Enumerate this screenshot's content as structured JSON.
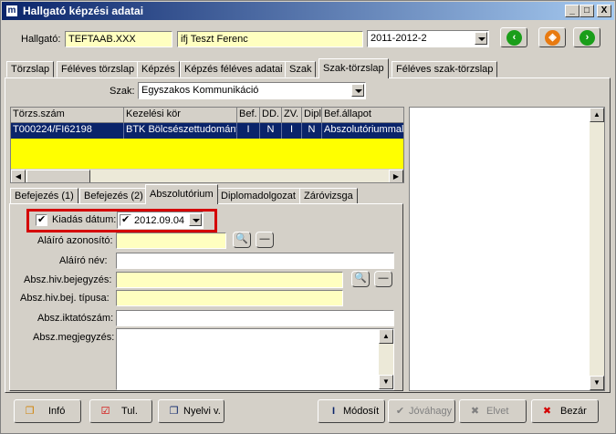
{
  "window": {
    "title": "Hallgató képzési adatai",
    "min": "_",
    "max": "□",
    "close": "X"
  },
  "header": {
    "student_label": "Hallgató:",
    "student_code": "TEFTAAB.XXX",
    "student_name": "ifj Teszt Ferenc",
    "semester": "2011-2012-2"
  },
  "main_tabs": [
    "Törzslap",
    "Féléves törzslap",
    "Képzés",
    "Képzés féléves adatai",
    "Szak",
    "Szak-törzslap",
    "Féléves szak-törzslap"
  ],
  "szak": {
    "label": "Szak:",
    "value": "Egyszakos Kommunikáció"
  },
  "grid": {
    "columns": [
      "Törzs.szám",
      "Kezelési kör",
      "Bef.",
      "DD.",
      "ZV.",
      "Dipl",
      "Bef.állapot"
    ],
    "rows": [
      [
        "T000224/FI62198",
        "BTK Bölcsészettudomány",
        "I",
        "N",
        "I",
        "N",
        "Abszolutóriummal"
      ]
    ]
  },
  "sub_tabs": [
    "Befejezés (1)",
    "Befejezés (2)",
    "Abszolutórium",
    "Diplomadolgozat",
    "Záróvizsga"
  ],
  "form": {
    "issue_date_label": "Kiadás dátum:",
    "issue_date": "2012.09.04",
    "signer_id_label": "Aláíró azonosító:",
    "signer_name_label": "Aláíró név:",
    "abs_ref_label": "Absz.hiv.bejegyzés:",
    "abs_ref_type_label": "Absz.hiv.bej. típusa:",
    "abs_file_label": "Absz.iktatószám:",
    "abs_note_label": "Absz.megjegyzés:"
  },
  "buttons": {
    "info": "Infó",
    "tul": "Tul.",
    "nyelvi": "Nyelvi v.",
    "modosit": "Módosít",
    "jovahagy": "Jóváhagy",
    "elvet": "Elvet",
    "bezar": "Bezár"
  },
  "colors": {
    "title_start": "#0a246a",
    "highlight": "#d40000",
    "yellow_field": "#ffffc0",
    "nav_green": "#1a9e1a",
    "nav_orange": "#e87a10"
  }
}
